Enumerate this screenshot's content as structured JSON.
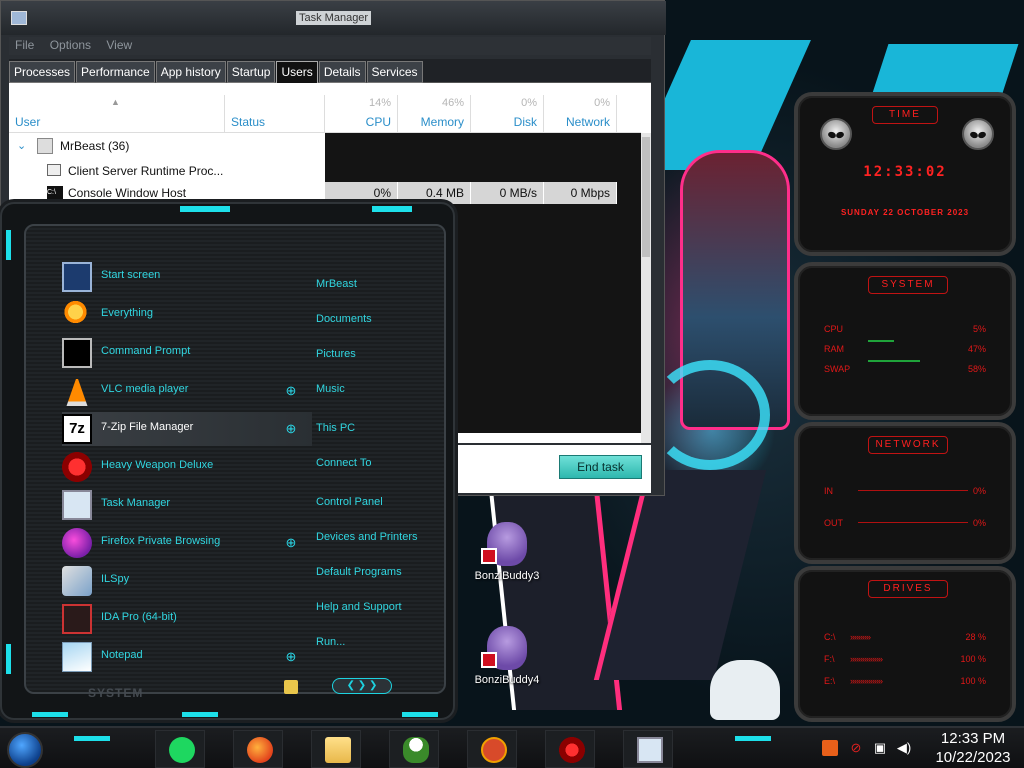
{
  "colors": {
    "accent_cyan": "#31d6e0",
    "glow_cyan": "#1de0ea",
    "widget_red": "#ff2020",
    "tm_header_blue": "#2a8ec9",
    "end_task_teal": "#2eb7ae"
  },
  "desktop": {
    "icons": [
      {
        "label": "BonziBuddy3",
        "icon": "bonzi-purple-gorilla-icon"
      },
      {
        "label": "BonziBuddy4",
        "icon": "bonzi-purple-gorilla-icon"
      }
    ]
  },
  "task_manager": {
    "title": "Task Manager",
    "menu": [
      "File",
      "Options",
      "View"
    ],
    "tabs": [
      "Processes",
      "Performance",
      "App history",
      "Startup",
      "Users",
      "Details",
      "Services"
    ],
    "active_tab": "Users",
    "columns": {
      "user": {
        "label": "User"
      },
      "status": {
        "label": "Status"
      },
      "cpu": {
        "label": "CPU",
        "pct": "14%"
      },
      "memory": {
        "label": "Memory",
        "pct": "46%"
      },
      "disk": {
        "label": "Disk",
        "pct": "0%"
      },
      "network": {
        "label": "Network",
        "pct": "0%"
      }
    },
    "rows": [
      {
        "name": "MrBeast (36)",
        "icon": "user-icon"
      },
      {
        "name": "Client Server Runtime Proc...",
        "icon": "process-window-icon"
      },
      {
        "name": "Console Window Host",
        "icon": "console-icon",
        "cpu": "0%",
        "memory": "0.4 MB",
        "disk": "0 MB/s",
        "network": "0 Mbps"
      }
    ],
    "end_task_label": "End task"
  },
  "start_menu": {
    "left_items": [
      {
        "label": "Start screen",
        "icon": "start-screen-icon"
      },
      {
        "label": "Everything",
        "icon": "everything-search-icon"
      },
      {
        "label": "Command Prompt",
        "icon": "command-prompt-icon"
      },
      {
        "label": "VLC media player",
        "icon": "vlc-cone-icon",
        "expand": true
      },
      {
        "label": "7-Zip File Manager",
        "icon": "7zip-icon",
        "expand": true
      },
      {
        "label": "Heavy Weapon Deluxe",
        "icon": "heavy-weapon-icon"
      },
      {
        "label": "Task Manager",
        "icon": "task-manager-icon"
      },
      {
        "label": "Firefox Private Browsing",
        "icon": "firefox-private-icon",
        "expand": true
      },
      {
        "label": "ILSpy",
        "icon": "ilspy-icon"
      },
      {
        "label": "IDA Pro (64-bit)",
        "icon": "ida-pro-icon"
      },
      {
        "label": "Notepad",
        "icon": "notepad-icon",
        "expand": true
      }
    ],
    "right_items": [
      "MrBeast",
      "Documents",
      "Pictures",
      "Music",
      "This PC",
      "Connect To",
      "Control Panel",
      "Devices and Printers",
      "Default Programs",
      "Help and Support",
      "Run..."
    ],
    "footer_label": "SYSTEM"
  },
  "widgets": {
    "time": {
      "title": "TIME",
      "time": "12:33:02",
      "date": "SUNDAY 22 OCTOBER 2023"
    },
    "system": {
      "title": "SYSTEM",
      "rows": [
        {
          "label": "CPU",
          "value": "5%"
        },
        {
          "label": "RAM",
          "value": "47%"
        },
        {
          "label": "SWAP",
          "value": "58%"
        }
      ]
    },
    "network": {
      "title": "NETWORK",
      "rows": [
        {
          "label": "IN",
          "value": "0%"
        },
        {
          "label": "OUT",
          "value": "0%"
        }
      ]
    },
    "drives": {
      "title": "DRIVES",
      "rows": [
        {
          "label": "C:\\",
          "value": "28 %"
        },
        {
          "label": "F:\\",
          "value": "100 %"
        },
        {
          "label": "E:\\",
          "value": "100 %"
        }
      ]
    }
  },
  "taskbar": {
    "apps": [
      "spotify-icon",
      "firefox-icon",
      "file-explorer-icon",
      "plant-icon",
      "powerpoint-icon",
      "heavy-weapon-icon",
      "task-manager-icon"
    ],
    "tray_icons": [
      "flash-icon",
      "network-blocked-icon",
      "monitor-icon",
      "volume-icon"
    ],
    "clock_time": "12:33 PM",
    "clock_date": "10/22/2023"
  }
}
